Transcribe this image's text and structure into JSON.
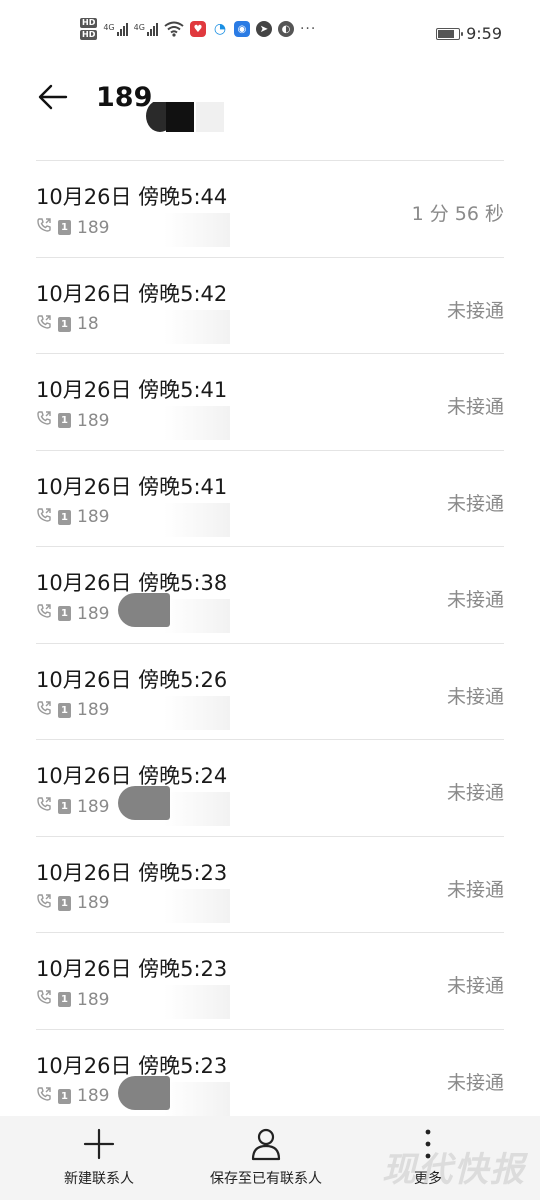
{
  "status_bar": {
    "network_left": "4G",
    "network_right": "4G",
    "hd_top": "HD",
    "hd_bottom": "HD",
    "more_indicator": "···",
    "time": "9:59",
    "battery_level": 0.85
  },
  "header": {
    "title": "189"
  },
  "calls": [
    {
      "date": "10月26日 傍晚5:44",
      "number": "189",
      "status": "1 分 56 秒",
      "sim": "1"
    },
    {
      "date": "10月26日 傍晚5:42",
      "number": "18",
      "status": "未接通",
      "sim": "1"
    },
    {
      "date": "10月26日 傍晚5:41",
      "number": "189",
      "status": "未接通",
      "sim": "1"
    },
    {
      "date": "10月26日 傍晚5:41",
      "number": "189",
      "status": "未接通",
      "sim": "1"
    },
    {
      "date": "10月26日 傍晚5:38",
      "number": "189",
      "status": "未接通",
      "sim": "1"
    },
    {
      "date": "10月26日 傍晚5:26",
      "number": "189",
      "status": "未接通",
      "sim": "1"
    },
    {
      "date": "10月26日 傍晚5:24",
      "number": "189",
      "status": "未接通",
      "sim": "1"
    },
    {
      "date": "10月26日 傍晚5:23",
      "number": "189",
      "status": "未接通",
      "sim": "1"
    },
    {
      "date": "10月26日 傍晚5:23",
      "number": "189",
      "status": "未接通",
      "sim": "1"
    },
    {
      "date": "10月26日 傍晚5:23",
      "number": "189",
      "status": "未接通",
      "sim": "1"
    }
  ],
  "bottom_bar": {
    "new_contact": "新建联系人",
    "save_existing": "保存至已有联系人",
    "more": "更多",
    "watermark": "现代快报"
  }
}
